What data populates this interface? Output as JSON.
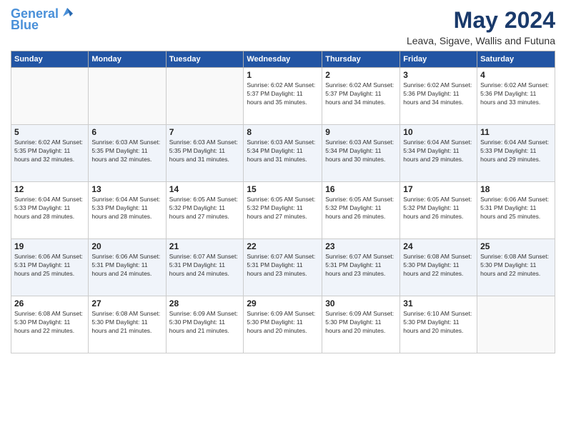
{
  "header": {
    "logo_line1": "General",
    "logo_line2": "Blue",
    "month": "May 2024",
    "location": "Leava, Sigave, Wallis and Futuna"
  },
  "weekdays": [
    "Sunday",
    "Monday",
    "Tuesday",
    "Wednesday",
    "Thursday",
    "Friday",
    "Saturday"
  ],
  "weeks": [
    [
      {
        "day": "",
        "info": ""
      },
      {
        "day": "",
        "info": ""
      },
      {
        "day": "",
        "info": ""
      },
      {
        "day": "1",
        "info": "Sunrise: 6:02 AM\nSunset: 5:37 PM\nDaylight: 11 hours\nand 35 minutes."
      },
      {
        "day": "2",
        "info": "Sunrise: 6:02 AM\nSunset: 5:37 PM\nDaylight: 11 hours\nand 34 minutes."
      },
      {
        "day": "3",
        "info": "Sunrise: 6:02 AM\nSunset: 5:36 PM\nDaylight: 11 hours\nand 34 minutes."
      },
      {
        "day": "4",
        "info": "Sunrise: 6:02 AM\nSunset: 5:36 PM\nDaylight: 11 hours\nand 33 minutes."
      }
    ],
    [
      {
        "day": "5",
        "info": "Sunrise: 6:02 AM\nSunset: 5:35 PM\nDaylight: 11 hours\nand 32 minutes."
      },
      {
        "day": "6",
        "info": "Sunrise: 6:03 AM\nSunset: 5:35 PM\nDaylight: 11 hours\nand 32 minutes."
      },
      {
        "day": "7",
        "info": "Sunrise: 6:03 AM\nSunset: 5:35 PM\nDaylight: 11 hours\nand 31 minutes."
      },
      {
        "day": "8",
        "info": "Sunrise: 6:03 AM\nSunset: 5:34 PM\nDaylight: 11 hours\nand 31 minutes."
      },
      {
        "day": "9",
        "info": "Sunrise: 6:03 AM\nSunset: 5:34 PM\nDaylight: 11 hours\nand 30 minutes."
      },
      {
        "day": "10",
        "info": "Sunrise: 6:04 AM\nSunset: 5:34 PM\nDaylight: 11 hours\nand 29 minutes."
      },
      {
        "day": "11",
        "info": "Sunrise: 6:04 AM\nSunset: 5:33 PM\nDaylight: 11 hours\nand 29 minutes."
      }
    ],
    [
      {
        "day": "12",
        "info": "Sunrise: 6:04 AM\nSunset: 5:33 PM\nDaylight: 11 hours\nand 28 minutes."
      },
      {
        "day": "13",
        "info": "Sunrise: 6:04 AM\nSunset: 5:33 PM\nDaylight: 11 hours\nand 28 minutes."
      },
      {
        "day": "14",
        "info": "Sunrise: 6:05 AM\nSunset: 5:32 PM\nDaylight: 11 hours\nand 27 minutes."
      },
      {
        "day": "15",
        "info": "Sunrise: 6:05 AM\nSunset: 5:32 PM\nDaylight: 11 hours\nand 27 minutes."
      },
      {
        "day": "16",
        "info": "Sunrise: 6:05 AM\nSunset: 5:32 PM\nDaylight: 11 hours\nand 26 minutes."
      },
      {
        "day": "17",
        "info": "Sunrise: 6:05 AM\nSunset: 5:32 PM\nDaylight: 11 hours\nand 26 minutes."
      },
      {
        "day": "18",
        "info": "Sunrise: 6:06 AM\nSunset: 5:31 PM\nDaylight: 11 hours\nand 25 minutes."
      }
    ],
    [
      {
        "day": "19",
        "info": "Sunrise: 6:06 AM\nSunset: 5:31 PM\nDaylight: 11 hours\nand 25 minutes."
      },
      {
        "day": "20",
        "info": "Sunrise: 6:06 AM\nSunset: 5:31 PM\nDaylight: 11 hours\nand 24 minutes."
      },
      {
        "day": "21",
        "info": "Sunrise: 6:07 AM\nSunset: 5:31 PM\nDaylight: 11 hours\nand 24 minutes."
      },
      {
        "day": "22",
        "info": "Sunrise: 6:07 AM\nSunset: 5:31 PM\nDaylight: 11 hours\nand 23 minutes."
      },
      {
        "day": "23",
        "info": "Sunrise: 6:07 AM\nSunset: 5:31 PM\nDaylight: 11 hours\nand 23 minutes."
      },
      {
        "day": "24",
        "info": "Sunrise: 6:08 AM\nSunset: 5:30 PM\nDaylight: 11 hours\nand 22 minutes."
      },
      {
        "day": "25",
        "info": "Sunrise: 6:08 AM\nSunset: 5:30 PM\nDaylight: 11 hours\nand 22 minutes."
      }
    ],
    [
      {
        "day": "26",
        "info": "Sunrise: 6:08 AM\nSunset: 5:30 PM\nDaylight: 11 hours\nand 22 minutes."
      },
      {
        "day": "27",
        "info": "Sunrise: 6:08 AM\nSunset: 5:30 PM\nDaylight: 11 hours\nand 21 minutes."
      },
      {
        "day": "28",
        "info": "Sunrise: 6:09 AM\nSunset: 5:30 PM\nDaylight: 11 hours\nand 21 minutes."
      },
      {
        "day": "29",
        "info": "Sunrise: 6:09 AM\nSunset: 5:30 PM\nDaylight: 11 hours\nand 20 minutes."
      },
      {
        "day": "30",
        "info": "Sunrise: 6:09 AM\nSunset: 5:30 PM\nDaylight: 11 hours\nand 20 minutes."
      },
      {
        "day": "31",
        "info": "Sunrise: 6:10 AM\nSunset: 5:30 PM\nDaylight: 11 hours\nand 20 minutes."
      },
      {
        "day": "",
        "info": ""
      }
    ]
  ]
}
